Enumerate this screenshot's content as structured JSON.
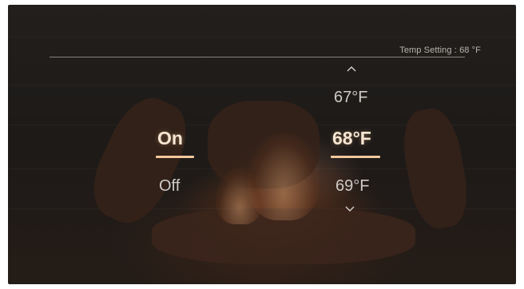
{
  "header": {
    "temp_setting": "Temp Setting : 68 °F"
  },
  "power": {
    "selected": "On",
    "other": "Off"
  },
  "temperature": {
    "above": "67°F",
    "selected": "68°F",
    "below": "69°F"
  },
  "icons": {
    "up": "chevron-up-icon",
    "down": "chevron-down-icon"
  },
  "colors": {
    "accent": "#f2c79c",
    "background": "#1f1c1a",
    "text": "#cfcac5"
  }
}
